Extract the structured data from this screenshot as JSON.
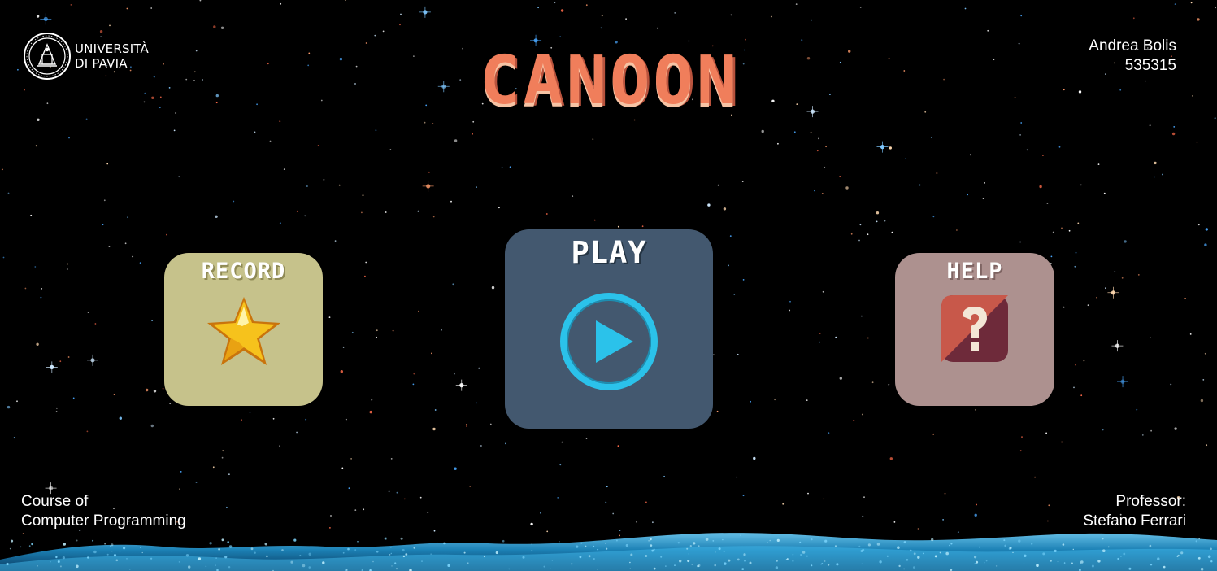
{
  "university_logo": {
    "line1": "UNIVERSITÀ",
    "line2": "DI PAVIA"
  },
  "game_title": "CANOON",
  "student": {
    "name": "Andrea Bolis",
    "id": "535315"
  },
  "menu": {
    "record": {
      "label": "RECORD",
      "icon": "star-icon",
      "color": "#c6c28b"
    },
    "play": {
      "label": "PLAY",
      "icon": "play-circle-icon",
      "color": "#43586f"
    },
    "help": {
      "label": "HELP",
      "icon": "question-mark-icon",
      "color": "#ad918f"
    }
  },
  "course": {
    "line1": "Course of",
    "line2": "Computer Programming"
  },
  "professor": {
    "line1": "Professor:",
    "line2": "Stefano Ferrari"
  },
  "colors": {
    "title": "#f07e5b",
    "background": "#000000",
    "wave": "#2f9fd6"
  }
}
